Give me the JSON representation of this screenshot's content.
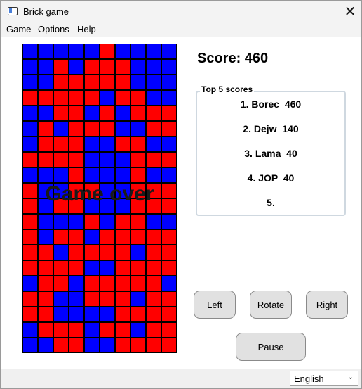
{
  "window": {
    "title": "Brick game",
    "close_glyph": "✕"
  },
  "menu": {
    "items": [
      "Game",
      "Options",
      "Help"
    ]
  },
  "board": {
    "rows": 20,
    "cols": 10,
    "colors": {
      "R": "#ff0000",
      "B": "#0000ff"
    },
    "grid": [
      "BBBBBRBBBB",
      "BBRBRRRBBB",
      "BBRRRRRBBB",
      "RRRRRBRRBB",
      "BBRRBRBRRR",
      "BRBRRRBBRR",
      "BRRRBBRRBB",
      "RRRRBBBRRR",
      "BBBRBBBRBB",
      "RBBRRBBRRR",
      "RBRRBBBRRR",
      "RBBBRBRRBB",
      "RBRRBRRRRR",
      "RRBRRRRBRR",
      "RRRRBBRRRR",
      "BRRBRRRRRB",
      "RRBBRRRBRR",
      "RRBBBBRRRR",
      "BRRRBRRBRR",
      "BBRRBBRRRR"
    ],
    "overlay_text": "Game over"
  },
  "score": {
    "text": "Score: 460"
  },
  "top_scores": {
    "legend": "Top 5 scores",
    "items": [
      "1. Borec  460",
      "2. Dejw  140",
      "3. Lama  40",
      "4. JOP  40",
      "5."
    ]
  },
  "controls": {
    "left": "Left",
    "rotate": "Rotate",
    "right": "Right",
    "pause": "Pause"
  },
  "language": {
    "selected": "English",
    "chevron": "⌄"
  }
}
